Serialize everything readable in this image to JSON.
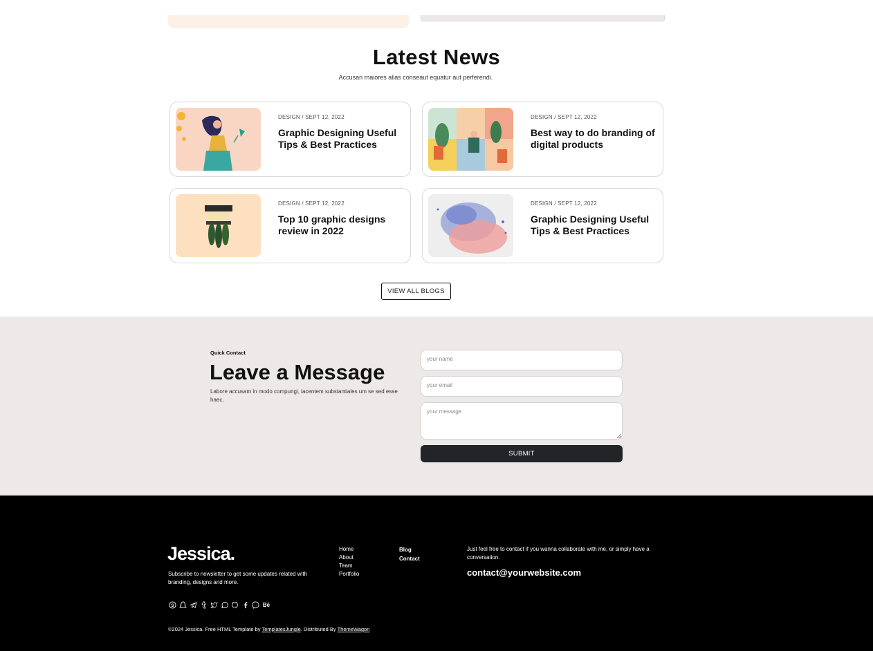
{
  "news": {
    "title": "Latest News",
    "subtitle": "Accusan maiores alias conseaut equatur aut perferendi.",
    "cards": [
      {
        "meta": "DESIGN / SEPT 12, 2022",
        "title": "Graphic Designing Useful Tips & Best Practices"
      },
      {
        "meta": "DESIGN / SEPT 12, 2022",
        "title": "Best way to do branding of digital products"
      },
      {
        "meta": "DESIGN / SEPT 12, 2022",
        "title": "Top 10 graphic designs review in 2022"
      },
      {
        "meta": "DESIGN / SEPT 12, 2022",
        "title": "Graphic Designing Useful Tips & Best Practices"
      }
    ],
    "view_all_label": "VIEW ALL BLOGS"
  },
  "contact": {
    "label": "Quick Contact",
    "title": "Leave a Message",
    "description": "Labore accusam in modo compungi, iacentem substantiales um se sed esse haec.",
    "name_placeholder": "your name",
    "email_placeholder": "your email",
    "message_placeholder": "your message",
    "submit_label": "SUBMIT"
  },
  "footer": {
    "logo": "Jessica.",
    "newsletter": "Subscribe to newsletter to get some updates related with branding, designs and more.",
    "nav_col1": [
      "Home",
      "About",
      "Team",
      "Portfolio"
    ],
    "nav_col2": [
      "Blog",
      "Contact"
    ],
    "collab_text": "Just feel free to contact if you wanna collaborate with me, or simply have a conversation.",
    "email": "contact@yourwebsite.com",
    "socials": [
      "skype-icon",
      "snapchat-icon",
      "telegram-icon",
      "tumblr-icon",
      "twitter-icon",
      "whatsapp-icon",
      "github-icon",
      "facebook-icon",
      "messenger-icon",
      "behance-icon"
    ],
    "copyright_prefix": "©2024 Jessica. Free HTML Template by ",
    "copyright_link1": "TemplatesJungle",
    "copyright_mid": ". Distributed By ",
    "copyright_link2": "ThemeWagon"
  }
}
